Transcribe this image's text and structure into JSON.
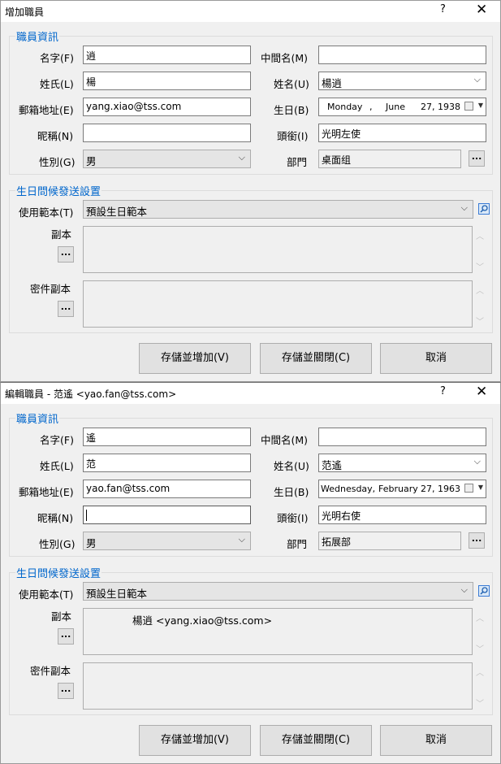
{
  "dialogs": [
    {
      "title": "增加職員",
      "help": "?",
      "close": "✕",
      "info_group_title": "職員資訊",
      "first_name_label": "名字(F)",
      "first_name_value": "逍",
      "middle_name_label": "中間名(M)",
      "middle_name_value": "",
      "last_name_label": "姓氏(L)",
      "last_name_value": "楊",
      "full_name_label": "姓名(U)",
      "full_name_value": "楊逍",
      "email_label": "郵箱地址(E)",
      "email_value": "yang.xiao@tss.com",
      "birthday_label": "生日(B)",
      "birthday_weekday": "Monday",
      "birthday_sep": ",",
      "birthday_month": "June",
      "birthday_day_year": "27, 1938",
      "nickname_label": "昵稱(N)",
      "nickname_value": "",
      "title_label": "頭銜(I)",
      "title_value": "光明左使",
      "gender_label": "性別(G)",
      "gender_value": "男",
      "department_label": "部門",
      "department_value": "桌面组",
      "browse": "...",
      "bday_group_title": "生日問候發送設置",
      "template_label": "使用範本(T)",
      "template_value": "預設生日範本",
      "cc_label": "副本",
      "cc_value": "",
      "bcc_label": "密件副本",
      "bcc_value": "",
      "save_add": "存儲並增加(V)",
      "save_close": "存儲並關閉(C)",
      "cancel": "取消"
    },
    {
      "title": "編輯職員 - 范遙 <yao.fan@tss.com>",
      "help": "?",
      "close": "✕",
      "info_group_title": "職員資訊",
      "first_name_label": "名字(F)",
      "first_name_value": "遙",
      "middle_name_label": "中間名(M)",
      "middle_name_value": "",
      "last_name_label": "姓氏(L)",
      "last_name_value": "范",
      "full_name_label": "姓名(U)",
      "full_name_value": "范遙",
      "email_label": "郵箱地址(E)",
      "email_value": "yao.fan@tss.com",
      "birthday_label": "生日(B)",
      "birthday_weekday": "Wednesday,",
      "birthday_sep": "",
      "birthday_month": "February",
      "birthday_day_year": "27, 1963",
      "nickname_label": "昵稱(N)",
      "nickname_value": "",
      "title_label": "頭銜(I)",
      "title_value": "光明右使",
      "gender_label": "性別(G)",
      "gender_value": "男",
      "department_label": "部門",
      "department_value": "拓展部",
      "browse": "...",
      "bday_group_title": "生日問候發送設置",
      "template_label": "使用範本(T)",
      "template_value": "預設生日範本",
      "cc_label": "副本",
      "cc_value": "楊逍 <yang.xiao@tss.com>",
      "bcc_label": "密件副本",
      "bcc_value": "",
      "save_add": "存儲並增加(V)",
      "save_close": "存儲並關閉(C)",
      "cancel": "取消"
    }
  ]
}
